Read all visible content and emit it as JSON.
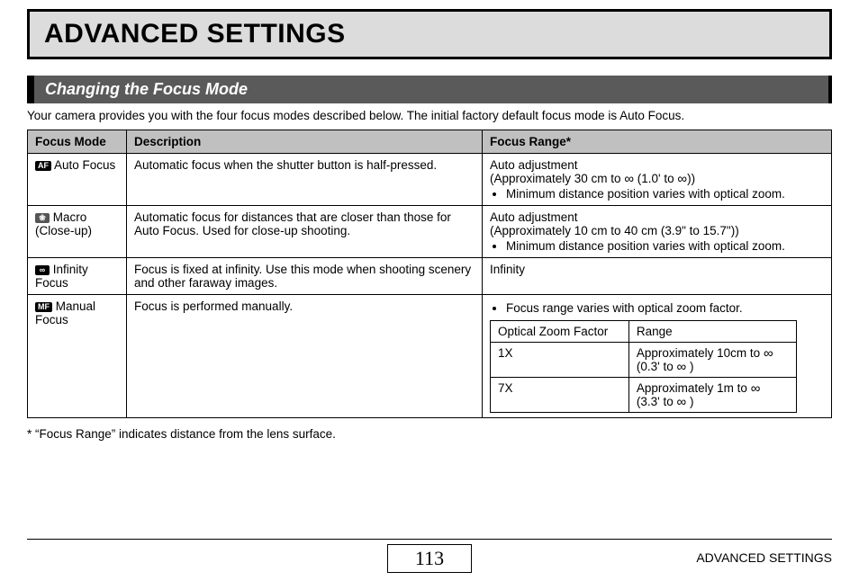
{
  "title": "ADVANCED SETTINGS",
  "section_header": "Changing the Focus Mode",
  "intro": "Your camera provides you with the four focus modes described below. The initial factory default focus mode is Auto Focus.",
  "table": {
    "headers": {
      "mode": "Focus Mode",
      "desc": "Description",
      "range": "Focus Range*"
    },
    "rows": [
      {
        "icon": "AF",
        "mode_text": " Auto Focus",
        "desc": "Automatic focus when the shutter button is half-pressed.",
        "range_line1": "Auto adjustment",
        "range_line2_a": "(Approximately 30 cm to ",
        "range_line2_b": " (1.0' to ",
        "range_line2_c": "))",
        "range_bullet": "Minimum distance position varies with optical zoom."
      },
      {
        "icon": "❀",
        "mode_text": " Macro (Close-up)",
        "desc": "Automatic focus for distances that are closer than those for Auto Focus. Used for close-up shooting.",
        "range_line1": "Auto adjustment",
        "range_line2": "(Approximately 10 cm to 40 cm (3.9\" to 15.7\"))",
        "range_bullet": "Minimum distance position varies with optical zoom."
      },
      {
        "icon": "∞",
        "mode_text": " Infinity Focus",
        "desc": "Focus is fixed at infinity. Use this mode when shooting scenery and other faraway images.",
        "range_line1": "Infinity"
      },
      {
        "icon": "MF",
        "mode_text": " Manual Focus",
        "desc": "Focus is performed manually.",
        "range_bullet": "Focus range varies with optical zoom factor.",
        "inner": {
          "h1": "Optical Zoom Factor",
          "h2": "Range",
          "r1c1": "1X",
          "r1c2a": "Approximately 10cm to ",
          "r1c2b": "(0.3' to ",
          "r1c2c": " )",
          "r2c1": "7X",
          "r2c2a": "Approximately 1m to ",
          "r2c2b": "(3.3' to ",
          "r2c2c": " )"
        }
      }
    ]
  },
  "infinity_symbol": "∞",
  "footnote": "*  “Focus Range” indicates distance from the lens surface.",
  "page_number": "113",
  "footer_label": "ADVANCED SETTINGS"
}
